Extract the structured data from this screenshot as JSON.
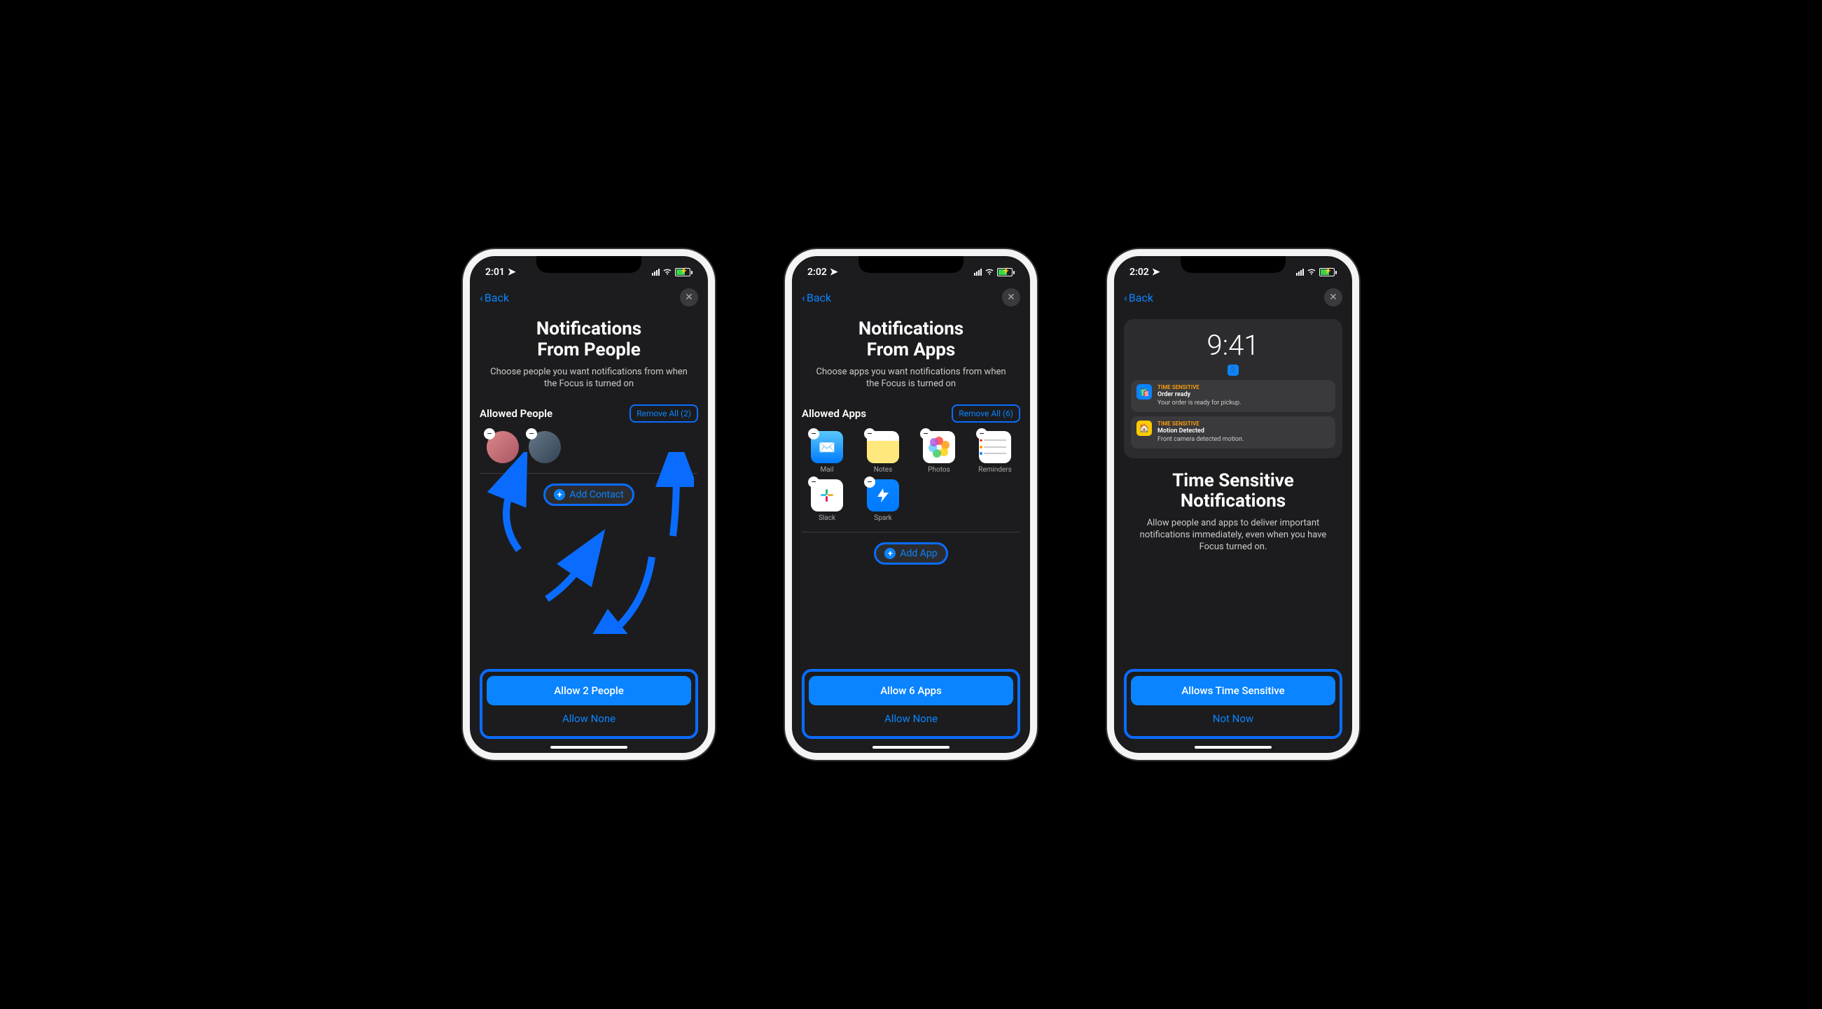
{
  "screen1": {
    "status_time": "2:01",
    "back": "Back",
    "title_l1": "Notifications",
    "title_l2": "From People",
    "subtitle": "Choose people you want notifications from when the Focus is turned on",
    "section": "Allowed People",
    "remove_all": "Remove All (2)",
    "add_btn": "Add Contact",
    "primary": "Allow 2 People",
    "secondary": "Allow None"
  },
  "screen2": {
    "status_time": "2:02",
    "back": "Back",
    "title_l1": "Notifications",
    "title_l2": "From Apps",
    "subtitle": "Choose apps you want notifications from when the Focus is turned on",
    "section": "Allowed Apps",
    "remove_all": "Remove All (6)",
    "apps": {
      "a1": "Mail",
      "a2": "Notes",
      "a3": "Photos",
      "a4": "Reminders",
      "a5": "Slack",
      "a6": "Spark"
    },
    "add_btn": "Add App",
    "primary": "Allow 6 Apps",
    "secondary": "Allow None"
  },
  "screen3": {
    "status_time": "2:02",
    "back": "Back",
    "preview_time": "9:41",
    "n1_tag": "TIME SENSITIVE",
    "n1_title": "Order ready",
    "n1_body": "Your order is ready for pickup.",
    "n2_tag": "TIME SENSITIVE",
    "n2_title": "Motion Detected",
    "n2_body": "Front camera detected motion.",
    "title_l1": "Time Sensitive",
    "title_l2": "Notifications",
    "subtitle": "Allow people and apps to deliver important notifications immediately, even when you have Focus turned on.",
    "primary": "Allows Time Sensitive",
    "secondary": "Not Now"
  }
}
